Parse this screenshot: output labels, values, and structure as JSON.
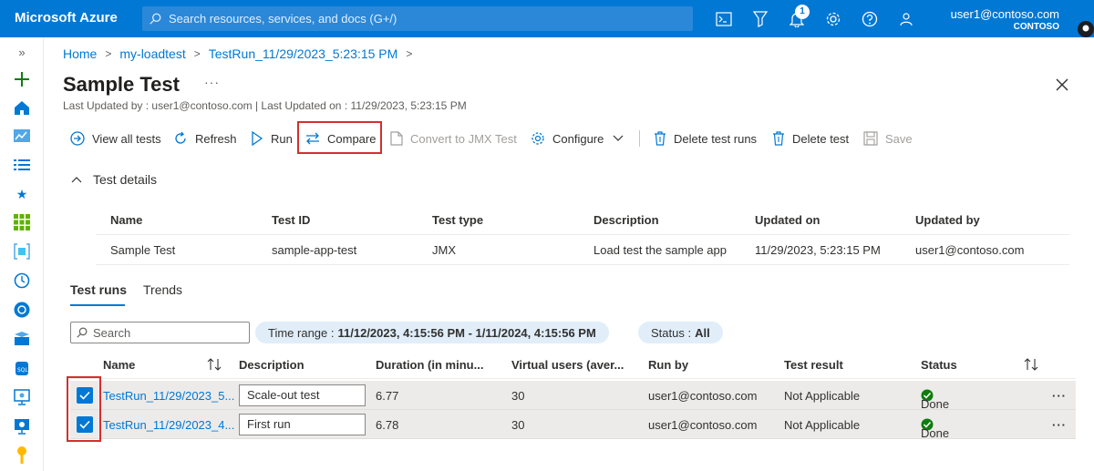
{
  "topbar": {
    "brand": "Microsoft Azure",
    "search_placeholder": "Search resources, services, and docs (G+/)",
    "notification_count": "1",
    "user_email": "user1@contoso.com",
    "user_org": "CONTOSO"
  },
  "breadcrumb": [
    "Home",
    "my-loadtest",
    "TestRun_11/29/2023_5:23:15 PM"
  ],
  "page": {
    "title": "Sample Test",
    "more": "···",
    "subtitle": "Last Updated by : user1@contoso.com | Last Updated on : 11/29/2023, 5:23:15 PM"
  },
  "toolbar": {
    "view_all": "View all tests",
    "refresh": "Refresh",
    "run": "Run",
    "compare": "Compare",
    "convert": "Convert to JMX Test",
    "configure": "Configure",
    "delete_runs": "Delete test runs",
    "delete_test": "Delete test",
    "save": "Save"
  },
  "details": {
    "section_label": "Test details",
    "columns": [
      "Name",
      "Test ID",
      "Test type",
      "Description",
      "Updated on",
      "Updated by"
    ],
    "row": [
      "Sample Test",
      "sample-app-test",
      "JMX",
      "Load test the sample app",
      "11/29/2023, 5:23:15 PM",
      "user1@contoso.com"
    ]
  },
  "tabs": [
    "Test runs",
    "Trends"
  ],
  "filters": {
    "search_placeholder": "Search",
    "time_label": "Time range :",
    "time_value": "11/12/2023, 4:15:56 PM - 1/11/2024, 4:15:56 PM",
    "status_label": "Status :",
    "status_value": "All"
  },
  "runs": {
    "columns": [
      "Name",
      "Description",
      "Duration (in minu...",
      "Virtual users (aver...",
      "Run by",
      "Test result",
      "Status"
    ],
    "rows": [
      {
        "name": "TestRun_11/29/2023_5...",
        "description": "Scale-out test",
        "duration": "6.77",
        "vusers": "30",
        "run_by": "user1@contoso.com",
        "result": "Not Applicable",
        "status": "Done"
      },
      {
        "name": "TestRun_11/29/2023_4...",
        "description": "First run",
        "duration": "6.78",
        "vusers": "30",
        "run_by": "user1@contoso.com",
        "result": "Not Applicable",
        "status": "Done"
      }
    ],
    "more": "···"
  },
  "colors": {
    "accent": "#0078d4",
    "highlight": "#d32f2f",
    "success": "#107c10"
  }
}
